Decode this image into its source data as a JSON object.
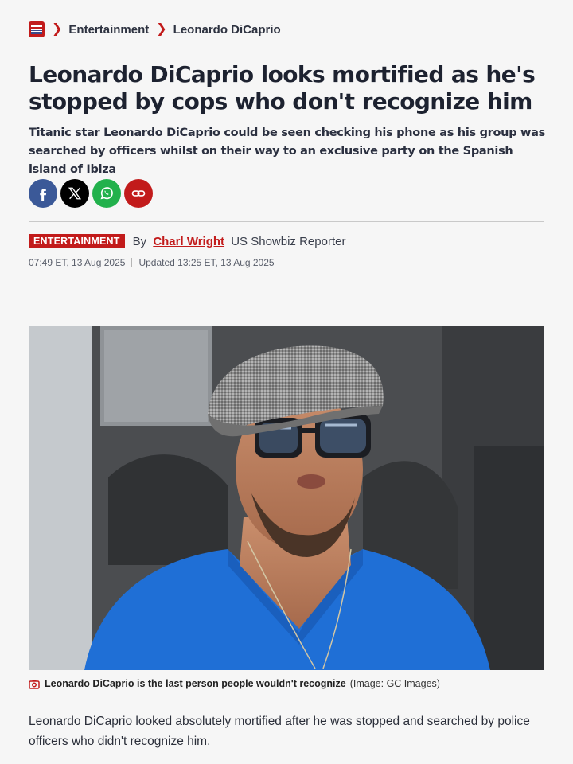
{
  "breadcrumb": {
    "items": [
      "Entertainment",
      "Leonardo DiCaprio"
    ]
  },
  "article": {
    "headline": "Leonardo DiCaprio looks mortified as he's stopped by cops who don't recognize him",
    "standfirst": "Titanic star Leonardo DiCaprio could be seen checking his phone as his group was searched by officers whilst on their way to an exclusive party on the Spanish island of Ibiza",
    "section_tag": "ENTERTAINMENT",
    "by_prefix": "By",
    "author": "Charl Wright",
    "author_role": "US Showbiz Reporter",
    "published": "07:49 ET, 13 Aug 2025",
    "updated": "Updated 13:25 ET, 13 Aug 2025",
    "image_caption": "Leonardo DiCaprio is the last person people wouldn't recognize",
    "image_credit": "(Image: GC Images)",
    "first_paragraph": "Leonardo DiCaprio looked absolutely mortified after he was stopped and searched by police officers who didn't recognize him."
  },
  "share": {
    "buttons": [
      {
        "icon": "facebook-icon",
        "color": "#3b5998"
      },
      {
        "icon": "x-icon",
        "color": "#000000"
      },
      {
        "icon": "whatsapp-icon",
        "color": "#22b14c"
      },
      {
        "icon": "link-icon",
        "color": "#c21b1b"
      }
    ]
  },
  "colors": {
    "accent": "#c21b1b",
    "headline": "#1d2230",
    "background": "#f6f6f6"
  }
}
